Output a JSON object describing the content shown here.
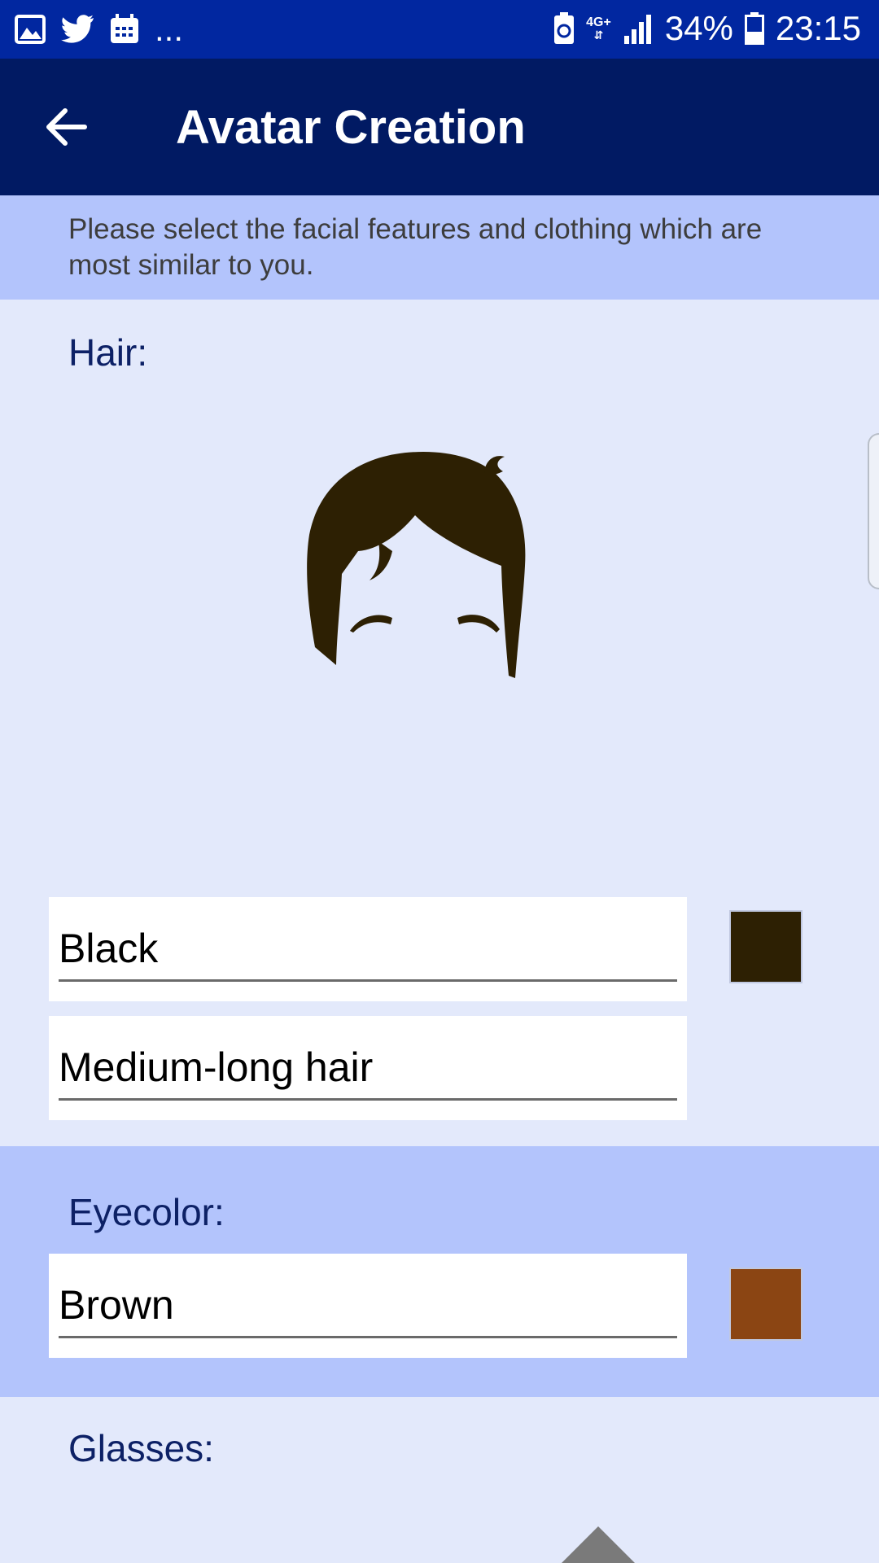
{
  "status_bar": {
    "network": "4G+",
    "battery": "34%",
    "time": "23:15",
    "overflow": "...",
    "icons": [
      "gallery-icon",
      "twitter-icon",
      "calendar-icon",
      "battery-saver-icon",
      "signal-icon",
      "battery-icon"
    ]
  },
  "app_bar": {
    "title": "Avatar Creation",
    "back_icon": "arrow-back-icon"
  },
  "intro": {
    "text": "Please select the facial features and clothing which are most similar to you."
  },
  "hair": {
    "label": "Hair:",
    "color_value": "Black",
    "style_value": "Medium-long hair",
    "swatch_color": "#2d2003",
    "image": "hair-medium-long-icon"
  },
  "eyecolor": {
    "label": "Eyecolor:",
    "value": "Brown",
    "swatch_color": "#8b4513"
  },
  "glasses": {
    "label": "Glasses:"
  },
  "colors": {
    "status_bar": "#0127a0",
    "app_bar": "#011a63",
    "page_bg": "#e3e9fb",
    "band_bg": "#b3c4fc",
    "label_text": "#0d2166"
  }
}
